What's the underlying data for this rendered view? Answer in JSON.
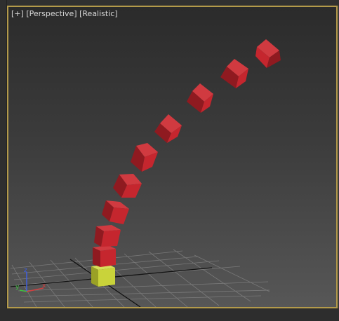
{
  "viewport": {
    "label_plus": "[+]",
    "label_view": "[Perspective]",
    "label_shading": "[Realistic]"
  },
  "axes": {
    "x_label": "x",
    "y_label": "y",
    "z_label": "z",
    "x_color": "#d04040",
    "y_color": "#40c040",
    "z_color": "#4060e0"
  },
  "colors": {
    "cube_red": "#c5262e",
    "cube_base": "#c9d33a",
    "viewport_border": "#b39a4a",
    "grid": "#8a8a8a"
  }
}
